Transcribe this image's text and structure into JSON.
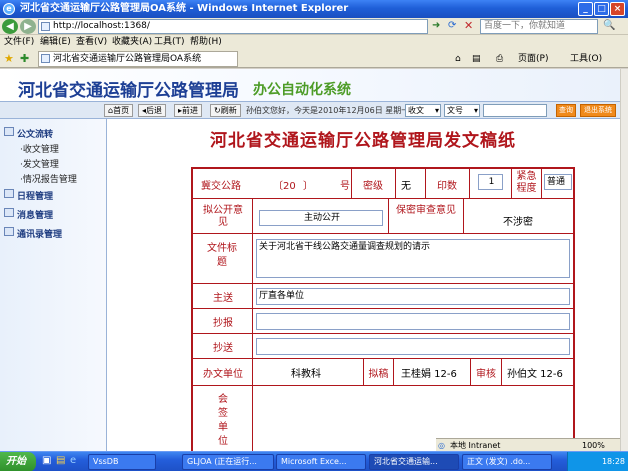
{
  "window": {
    "title": "河北省交通运输厅公路管理局OA系统 - Windows Internet Explorer"
  },
  "addressbar": {
    "url": "http://localhost:1368/",
    "search_placeholder": "百度一下，你就知道"
  },
  "menu": [
    "文件(F)",
    "编辑(E)",
    "查看(V)",
    "收藏夹(A)",
    "工具(T)",
    "帮助(H)"
  ],
  "favbar": {
    "tab_label": "河北省交通运输厅公路管理局OA系统",
    "page_label": "页面(P)",
    "tools_label": "工具(O)"
  },
  "banner": {
    "title": "河北省交通运输厅公路管理局",
    "subtitle": "办公自动化系统"
  },
  "toolbar": {
    "home": "首页",
    "back": "后退",
    "forward": "前进",
    "refresh": "刷新",
    "welcome": "孙伯文您好，今天是2010年12月06日 星期一",
    "select1": "收文",
    "select2": "文号",
    "query_button": "查询",
    "logout_button": "退出系统"
  },
  "sidebar": {
    "sections": [
      {
        "label": "公文流转",
        "items": [
          "收文管理",
          "发文管理",
          "情况报告管理"
        ]
      },
      {
        "label": "日程管理",
        "items": []
      },
      {
        "label": "消息管理",
        "items": []
      },
      {
        "label": "通讯录管理",
        "items": []
      }
    ]
  },
  "document": {
    "title": "河北省交通运输厅公路管理局发文稿纸",
    "row1": {
      "prefix": "冀交公路",
      "year_open": "〔20",
      "year_close": "〕",
      "number_label": "号",
      "secret_label": "密级",
      "secret_value": "无",
      "copies_label": "印数",
      "copies_value": "1",
      "urgency_label": "紧急程度",
      "urgency_value": "普通"
    },
    "row2": {
      "disclosure_label": "拟公开意见",
      "disclosure_value": "主动公开",
      "secrecy_review_label": "保密审查意见",
      "secrecy_review_value": "不涉密"
    },
    "row3": {
      "label": "文件标题",
      "value": "关于河北省干线公路交通量调查规划的请示"
    },
    "row4": {
      "label": "主送",
      "value": "厅直各单位"
    },
    "row5": {
      "label": "抄报",
      "value": ""
    },
    "row6": {
      "label": "抄送",
      "value": ""
    },
    "row7": {
      "unit_label": "办文单位",
      "unit_value": "科教科",
      "draft_label": "拟稿",
      "draft_value": "王桂娟 12-6",
      "review_label": "审核",
      "review_value": "孙伯文 12-6"
    },
    "row8": {
      "label": "会签单位"
    }
  },
  "statusbar": {
    "zone": "本地 Intranet",
    "zoom": "100%"
  },
  "taskbar": {
    "start": "开始",
    "tasks": [
      "VssDB",
      "GLJOA (正在运行...",
      "Microsoft Exce...",
      "河北省交通运输...",
      "正文 (发文) .do..."
    ],
    "clock": "18:28"
  }
}
